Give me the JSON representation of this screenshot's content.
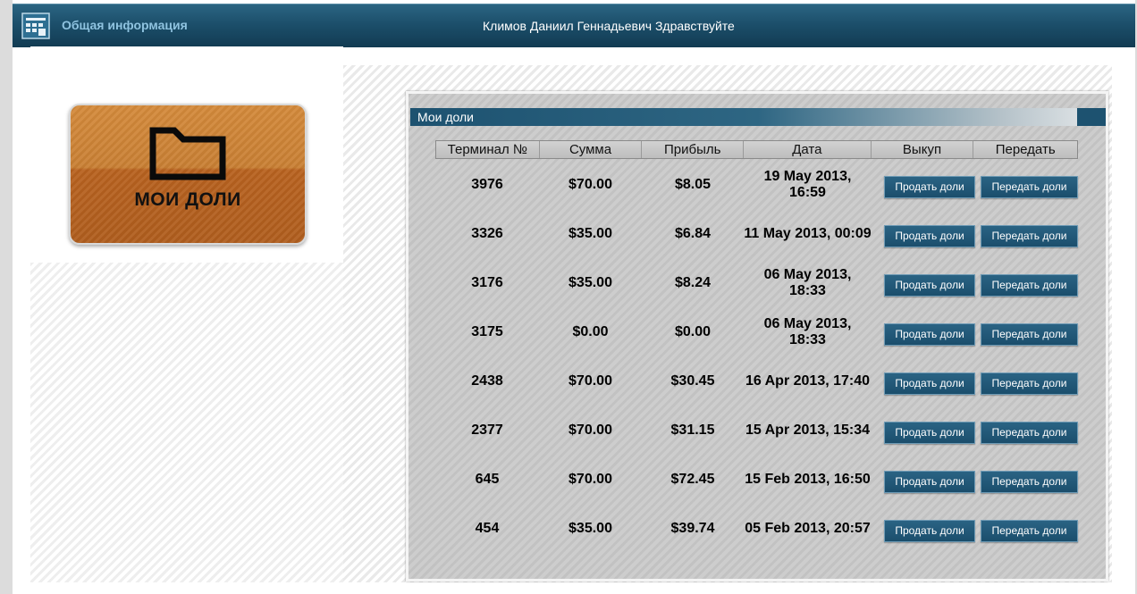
{
  "header": {
    "section_title": "Общая информация",
    "greeting": "Климов Даниил Геннадьевич Здравствуйте",
    "icon": "grid-calendar-icon"
  },
  "tile": {
    "label": "МОИ ДОЛИ",
    "icon": "folder-icon"
  },
  "panel": {
    "title": "Мои доли"
  },
  "table": {
    "columns": [
      "Терминал №",
      "Сумма",
      "Прибыль",
      "Дата",
      "Выкуп",
      "Передать"
    ],
    "sell_label": "Продать доли",
    "transfer_label": "Передать доли",
    "rows": [
      {
        "terminal": "3976",
        "sum": "$70.00",
        "profit": "$8.05",
        "date": "19 May 2013, 16:59"
      },
      {
        "terminal": "3326",
        "sum": "$35.00",
        "profit": "$6.84",
        "date": "11 May 2013, 00:09"
      },
      {
        "terminal": "3176",
        "sum": "$35.00",
        "profit": "$8.24",
        "date": "06 May 2013, 18:33"
      },
      {
        "terminal": "3175",
        "sum": "$0.00",
        "profit": "$0.00",
        "date": "06 May 2013, 18:33"
      },
      {
        "terminal": "2438",
        "sum": "$70.00",
        "profit": "$30.45",
        "date": "16 Apr 2013, 17:40"
      },
      {
        "terminal": "2377",
        "sum": "$70.00",
        "profit": "$31.15",
        "date": "15 Apr 2013, 15:34"
      },
      {
        "terminal": "645",
        "sum": "$70.00",
        "profit": "$72.45",
        "date": "15 Feb 2013, 16:50"
      },
      {
        "terminal": "454",
        "sum": "$35.00",
        "profit": "$39.74",
        "date": "05 Feb 2013, 20:57"
      }
    ]
  },
  "colors": {
    "topbar": "#1c4f6b",
    "button": "#1b4e6c",
    "tile": "#c98034"
  }
}
